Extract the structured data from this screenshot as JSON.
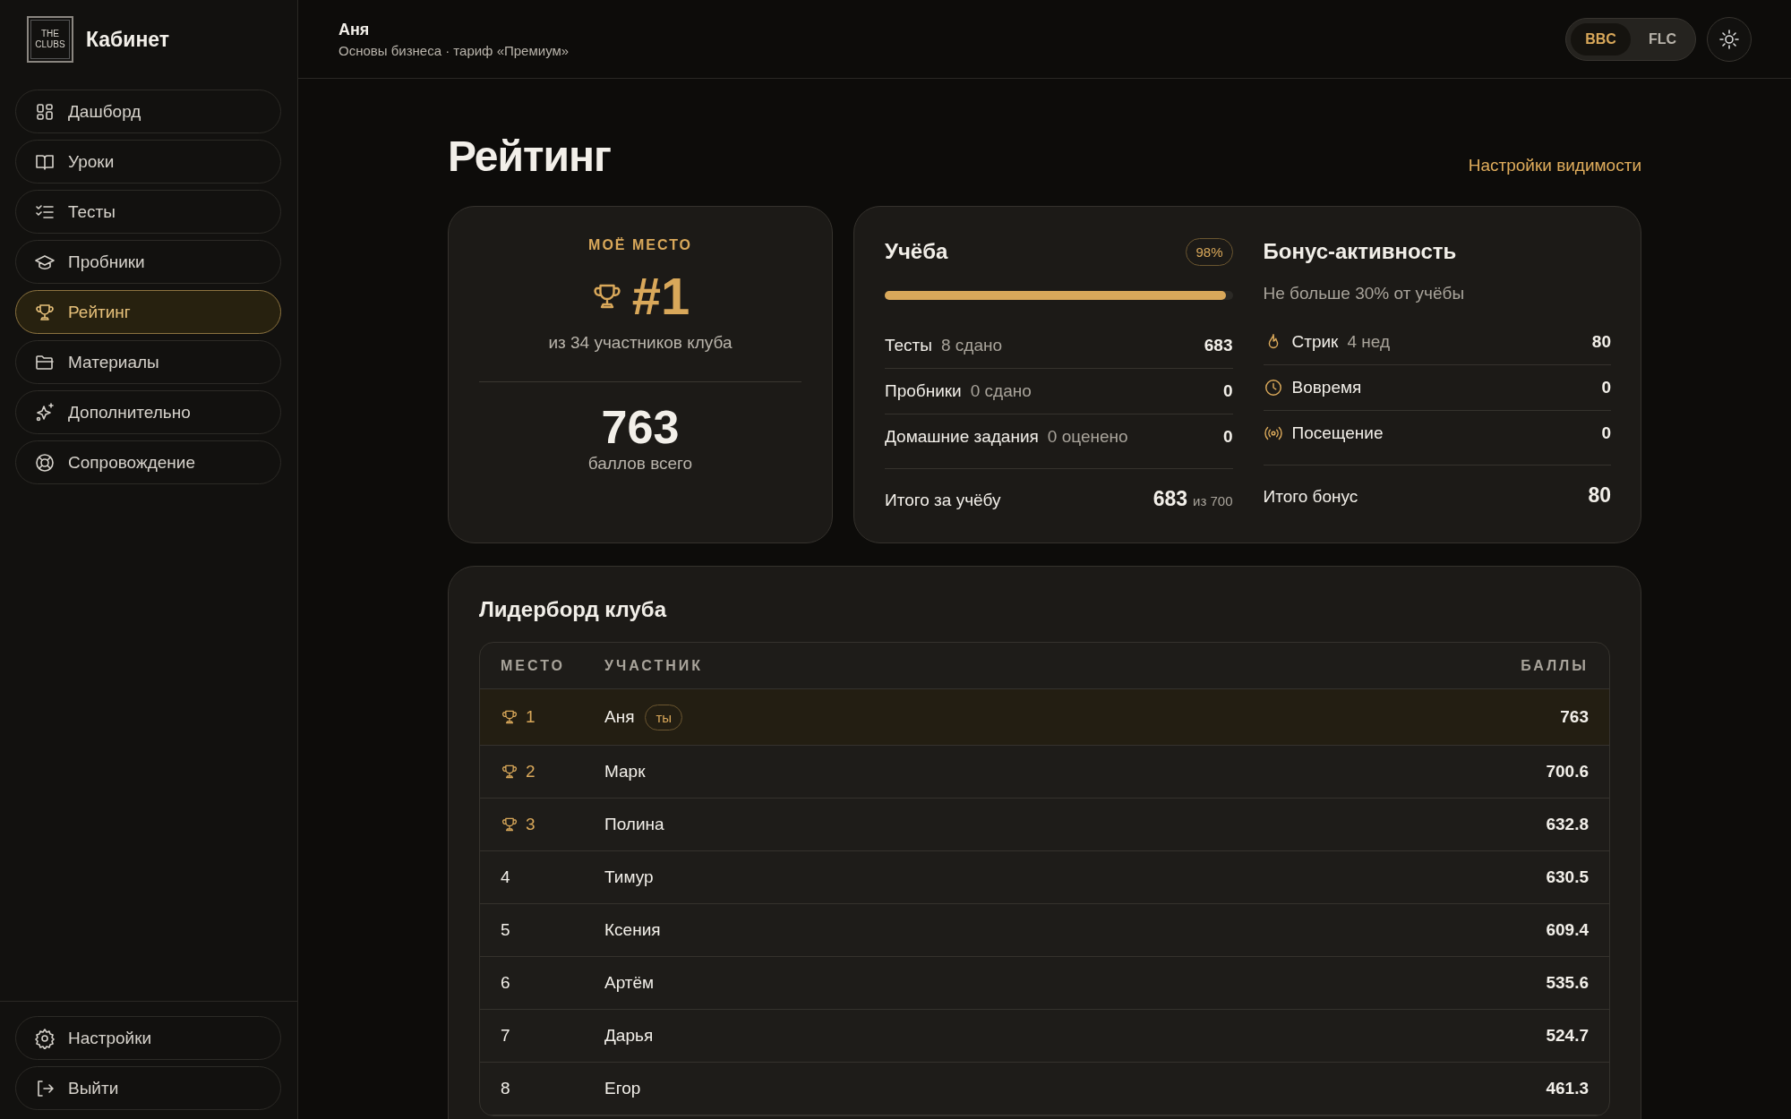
{
  "sidebar": {
    "logo": {
      "line1": "THE",
      "line2": "CLUBS"
    },
    "title": "Кабинет",
    "items": [
      {
        "label": "Дашборд",
        "selected": false
      },
      {
        "label": "Уроки",
        "selected": false
      },
      {
        "label": "Тесты",
        "selected": false
      },
      {
        "label": "Пробники",
        "selected": false
      },
      {
        "label": "Рейтинг",
        "selected": true
      },
      {
        "label": "Материалы",
        "selected": false
      },
      {
        "label": "Дополнительно",
        "selected": false
      },
      {
        "label": "Сопровождение",
        "selected": false
      }
    ],
    "bottom_items": [
      {
        "label": "Настройки"
      },
      {
        "label": "Выйти"
      }
    ]
  },
  "header": {
    "name": "Аня",
    "subtitle": "Основы бизнеса · тариф «Премиум»",
    "switch": [
      {
        "label": "BBC",
        "selected": true
      },
      {
        "label": "FLC",
        "selected": false
      }
    ]
  },
  "page": {
    "title": "Рейтинг",
    "link": "Настройки видимости"
  },
  "my_place": {
    "label": "МОЁ МЕСТО",
    "place": "#1",
    "of": "из 34 участников клуба",
    "points": "763",
    "points_label": "баллов всего"
  },
  "study": {
    "title": "Учёба",
    "percent": "98%",
    "level": 0.98,
    "rows": [
      {
        "label": "Тесты",
        "note": "8 сдано",
        "value": "683"
      },
      {
        "label": "Пробники",
        "note": "0 сдано",
        "value": "0"
      },
      {
        "label": "Домашние задания",
        "note": "0 оценено",
        "value": "0"
      }
    ],
    "total_label": "Итого за учёбу",
    "total": "683",
    "total_of": "из 700"
  },
  "bonus": {
    "title": "Бонус-активность",
    "subtitle": "Не больше 30% от учёбы",
    "rows": [
      {
        "label": "Стрик",
        "note": "4 нед",
        "value": "80"
      },
      {
        "label": "Вовремя",
        "value": "0"
      },
      {
        "label": "Посещение",
        "value": "0"
      }
    ],
    "total_label": "Итого бонус",
    "total": "80"
  },
  "leaderboard": {
    "title": "Лидерборд клуба",
    "columns": [
      "МЕСТО",
      "УЧАСТНИК",
      "БАЛЛЫ"
    ],
    "rows": [
      {
        "place": "1",
        "trophy": true,
        "name": "Аня",
        "badge": "ты",
        "points": "763",
        "selected": true
      },
      {
        "place": "2",
        "trophy": true,
        "name": "Марк",
        "points": "700.6",
        "selected": false
      },
      {
        "place": "3",
        "trophy": true,
        "name": "Полина",
        "points": "632.8",
        "selected": false
      },
      {
        "place": "4",
        "trophy": false,
        "name": "Тимур",
        "points": "630.5",
        "selected": false
      },
      {
        "place": "5",
        "trophy": false,
        "name": "Ксения",
        "points": "609.4",
        "selected": false
      },
      {
        "place": "6",
        "trophy": false,
        "name": "Артём",
        "points": "535.6",
        "selected": false
      },
      {
        "place": "7",
        "trophy": false,
        "name": "Дарья",
        "points": "524.7",
        "selected": false
      },
      {
        "place": "8",
        "trophy": false,
        "name": "Егор",
        "points": "461.3",
        "selected": false
      }
    ]
  }
}
